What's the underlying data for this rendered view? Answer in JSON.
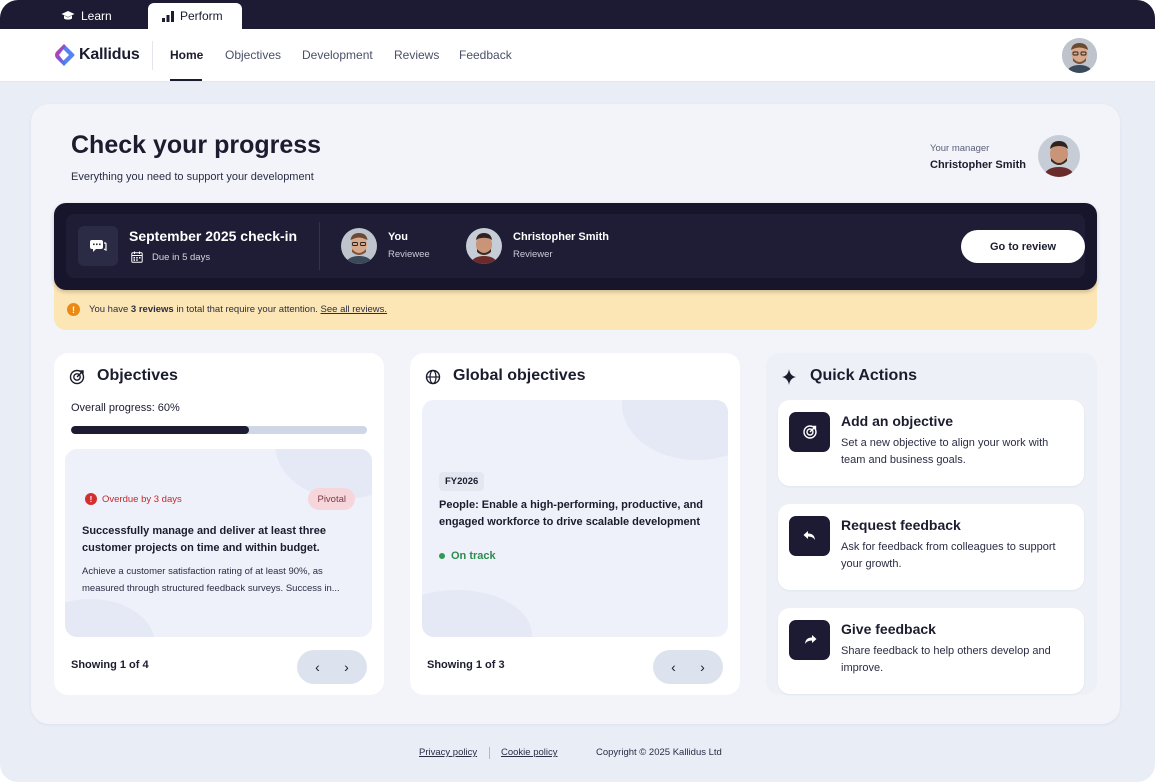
{
  "appbar": {
    "learn_label": "Learn",
    "perform_label": "Perform"
  },
  "nav": {
    "brand": "Kallidus",
    "items": [
      {
        "label": "Home",
        "active": true
      },
      {
        "label": "Objectives"
      },
      {
        "label": "Development"
      },
      {
        "label": "Reviews"
      },
      {
        "label": "Feedback"
      }
    ]
  },
  "header": {
    "title": "Check your progress",
    "subtitle": "Everything you need to support your development",
    "manager_label": "Your manager",
    "manager_name": "Christopher Smith"
  },
  "checkin": {
    "title": "September 2025 check-in",
    "due": "Due in 5 days",
    "reviewee_name": "You",
    "reviewee_role": "Reviewee",
    "reviewer_name": "Christopher Smith",
    "reviewer_role": "Reviewer",
    "button": "Go to review"
  },
  "alert": {
    "prefix": "You have ",
    "count": "3 reviews",
    "middle": " in total that require your attention. ",
    "link": "See all reviews."
  },
  "objectives": {
    "title": "Objectives",
    "progress_label": "Overall progress: 60%",
    "progress_fraction": 0.6,
    "item": {
      "status": "Overdue by 3 days",
      "tag": "Pivotal",
      "title": "Successfully manage and deliver at least three customer projects on time and within budget.",
      "description": "Achieve a customer satisfaction rating of at least 90%, as measured through structured feedback surveys. Success in..."
    },
    "showing": "Showing 1 of 4"
  },
  "global_objectives": {
    "title": "Global objectives",
    "item": {
      "tag": "FY2026",
      "title": "People: Enable a high-performing, productive, and engaged workforce to drive scalable development",
      "status": "On track"
    },
    "showing": "Showing 1 of 3"
  },
  "quick_actions": {
    "title": "Quick Actions",
    "items": [
      {
        "title": "Add an objective",
        "description": "Set a new objective to align your work with team and business goals.",
        "icon": "target-icon"
      },
      {
        "title": "Request feedback",
        "description": "Ask for feedback from colleagues to support your growth.",
        "icon": "reply-icon"
      },
      {
        "title": "Give feedback",
        "description": "Share feedback to help others develop and improve.",
        "icon": "share-icon"
      }
    ]
  },
  "pager": {
    "prev": "‹",
    "next": "›"
  },
  "footer": {
    "privacy": "Privacy policy",
    "cookie": "Cookie policy",
    "copyright": "Copyright © 2025 Kallidus Ltd"
  },
  "colors": {
    "dark": "#1c1b33",
    "accent_gradient_start": "#e8396f",
    "accent_gradient_end": "#3a6df0",
    "alert_bg": "#fde6b5",
    "on_track": "#2e8b4f",
    "overdue": "#c62828"
  }
}
